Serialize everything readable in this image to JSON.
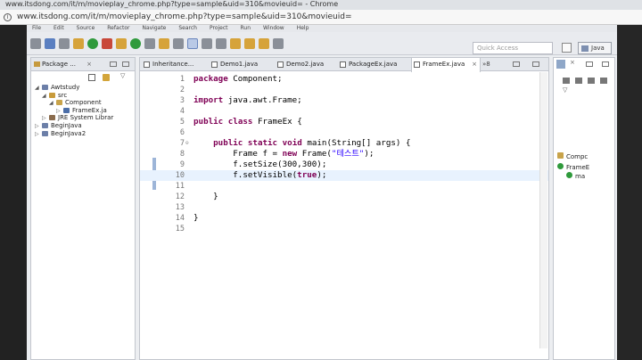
{
  "browser": {
    "title": "www.itsdong.com/it/m/movieplay_chrome.php?type=sample&uid=310&movieuid= - Chrome",
    "url": "www.itsdong.com/it/m/movieplay_chrome.php?type=sample&uid=310&movieuid="
  },
  "menu": [
    "File",
    "Edit",
    "Source",
    "Refactor",
    "Navigate",
    "Search",
    "Project",
    "Run",
    "Window",
    "Help"
  ],
  "toolbar": {
    "quick_access_placeholder": "Quick Access",
    "perspective": "Java"
  },
  "package_explorer": {
    "title": "Package ...",
    "tree": [
      {
        "label": "Awtstudy",
        "level": 0,
        "icon": "project-icon"
      },
      {
        "label": "src",
        "level": 1,
        "icon": "source-folder-icon"
      },
      {
        "label": "Component",
        "level": 2,
        "icon": "package-icon"
      },
      {
        "label": "FrameEx.ja",
        "level": 3,
        "icon": "java-file-icon"
      },
      {
        "label": "JRE System Librar",
        "level": 1,
        "icon": "library-icon"
      },
      {
        "label": "BeginJava",
        "level": 0,
        "icon": "project-icon"
      },
      {
        "label": "BeginJava2",
        "level": 0,
        "icon": "project-icon"
      }
    ]
  },
  "editor": {
    "tabs": [
      "Inheritance...",
      "Demo1.java",
      "Demo2.java",
      "PackageEx.java",
      "FrameEx.java"
    ],
    "active_tab": "FrameEx.java",
    "overflow_count": "»8",
    "lines": [
      {
        "n": "1",
        "tokens": [
          {
            "t": "package",
            "c": "kw"
          },
          {
            "t": " Component;",
            "c": ""
          }
        ]
      },
      {
        "n": "2",
        "tokens": []
      },
      {
        "n": "3",
        "tokens": [
          {
            "t": "import",
            "c": "kw"
          },
          {
            "t": " java.awt.Frame;",
            "c": ""
          }
        ]
      },
      {
        "n": "4",
        "tokens": []
      },
      {
        "n": "5",
        "tokens": [
          {
            "t": "public",
            "c": "kw"
          },
          {
            "t": " ",
            "c": ""
          },
          {
            "t": "class",
            "c": "kw"
          },
          {
            "t": " FrameEx {",
            "c": ""
          }
        ]
      },
      {
        "n": "6",
        "tokens": []
      },
      {
        "n": "7",
        "tokens": [
          {
            "t": "    ",
            "c": ""
          },
          {
            "t": "public",
            "c": "kw"
          },
          {
            "t": " ",
            "c": ""
          },
          {
            "t": "static",
            "c": "kw"
          },
          {
            "t": " ",
            "c": ""
          },
          {
            "t": "void",
            "c": "kw"
          },
          {
            "t": " main(String[] args) {",
            "c": ""
          }
        ]
      },
      {
        "n": "8",
        "tokens": [
          {
            "t": "        Frame f = ",
            "c": ""
          },
          {
            "t": "new",
            "c": "kw"
          },
          {
            "t": " Frame(",
            "c": ""
          },
          {
            "t": "\"테스트\"",
            "c": "str"
          },
          {
            "t": ");",
            "c": ""
          }
        ]
      },
      {
        "n": "9",
        "tokens": [
          {
            "t": "        f.setSize(300,300);",
            "c": ""
          }
        ]
      },
      {
        "n": "10",
        "tokens": [
          {
            "t": "        f.setVisible(",
            "c": ""
          },
          {
            "t": "true",
            "c": "kw"
          },
          {
            "t": ");",
            "c": ""
          }
        ]
      },
      {
        "n": "11",
        "tokens": []
      },
      {
        "n": "12",
        "tokens": [
          {
            "t": "    }",
            "c": ""
          }
        ]
      },
      {
        "n": "13",
        "tokens": []
      },
      {
        "n": "14",
        "tokens": [
          {
            "t": "}",
            "c": ""
          }
        ]
      },
      {
        "n": "15",
        "tokens": []
      }
    ],
    "current_line": "10"
  },
  "outline": {
    "items": [
      "Compc",
      "FrameE",
      "ma"
    ]
  }
}
